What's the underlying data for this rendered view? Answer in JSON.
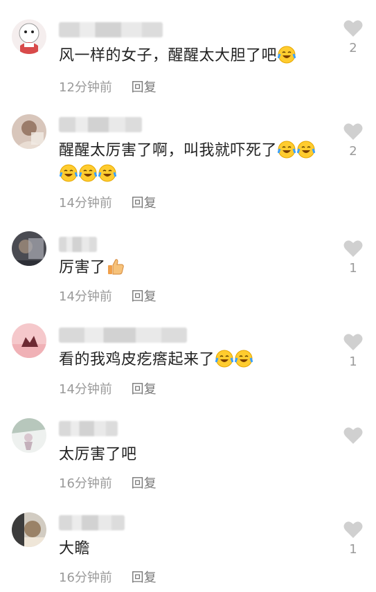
{
  "comments": [
    {
      "text": "风一样的女子，醒醒太大胆了吧",
      "emojis": 1,
      "time": "12分钟前",
      "reply": "回复",
      "likes": "2",
      "avatar_colors": [
        "#f3e7e7",
        "#d84a4a",
        "#ffffff"
      ]
    },
    {
      "text": "醒醒太厉害了啊，叫我就吓死了",
      "emojis": 5,
      "time": "14分钟前",
      "reply": "回复",
      "likes": "2",
      "avatar_colors": [
        "#c9b1a4",
        "#7a5f51",
        "#e7d8cd"
      ]
    },
    {
      "text": "厉害了",
      "emojis": 0,
      "thumb": true,
      "time": "14分钟前",
      "reply": "回复",
      "likes": "1",
      "avatar_colors": [
        "#6e6f75",
        "#3a3c44",
        "#a1a3ab"
      ]
    },
    {
      "text": "看的我鸡皮疙瘩起来了",
      "emojis": 2,
      "time": "14分钟前",
      "reply": "回复",
      "likes": "1",
      "avatar_colors": [
        "#f2c3c6",
        "#8a2e38",
        "#f7e1e2"
      ]
    },
    {
      "text": "太厉害了吧",
      "emojis": 0,
      "time": "16分钟前",
      "reply": "回复",
      "likes": "",
      "avatar_colors": [
        "#e6ebe8",
        "#9bb0a4",
        "#ffffff"
      ]
    },
    {
      "text": "大瞻",
      "emojis": 0,
      "time": "16分钟前",
      "reply": "回复",
      "likes": "1",
      "avatar_colors": [
        "#c8c2b8",
        "#6d5d4c",
        "#eadbc6"
      ]
    }
  ]
}
